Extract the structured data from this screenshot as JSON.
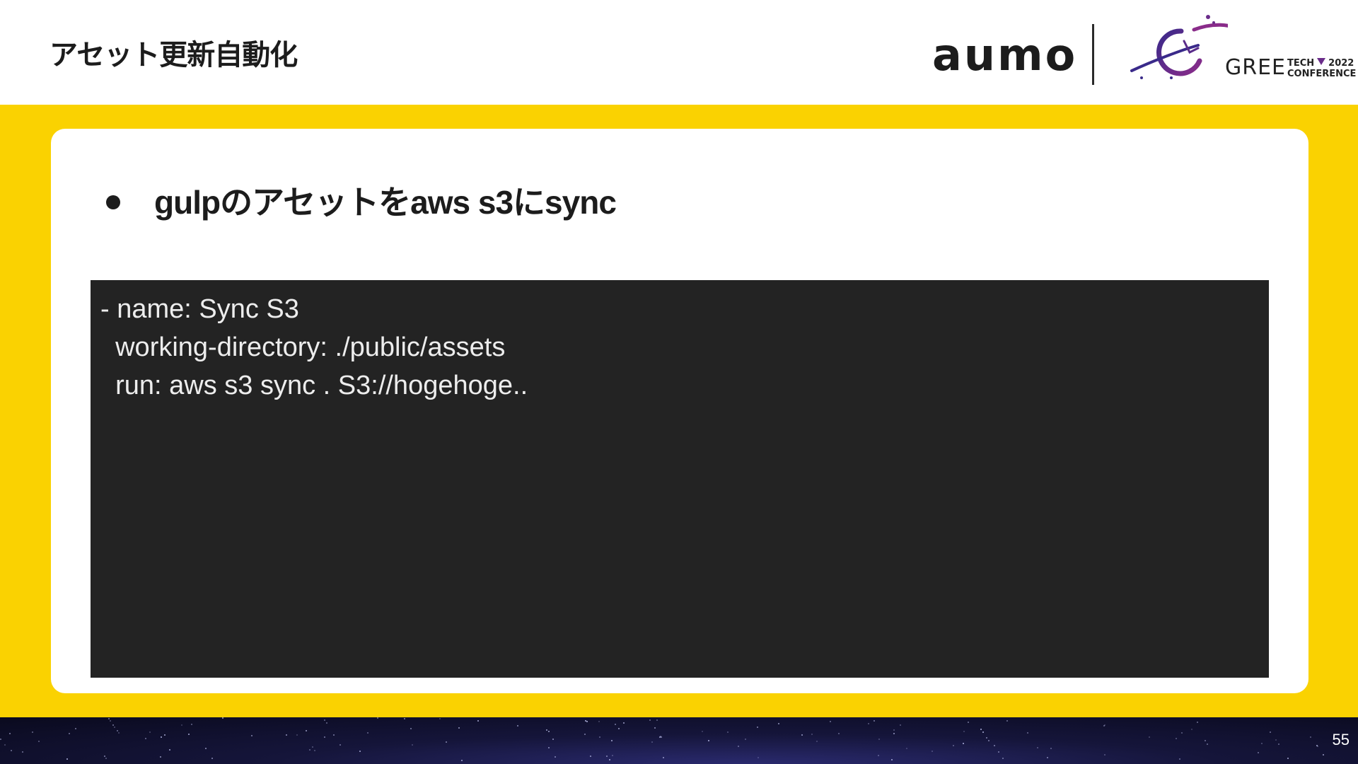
{
  "slide": {
    "title": "アセット更新自動化",
    "page_number": "55"
  },
  "logos": {
    "aumo": "aumo",
    "gree_word": "GREE",
    "gree_tech_line1": "TECH",
    "gree_year": "2022",
    "gree_tech_line2": "CONFERENCE"
  },
  "content": {
    "bullet": "gulpのアセットをaws s3にsync",
    "code_lines": [
      "- name: Sync S3",
      "  working-directory: ./public/assets",
      "  run: aws s3 sync . S3://hogehoge.."
    ]
  },
  "colors": {
    "accent_yellow": "#fad201",
    "code_background": "#232323",
    "gree_purple": "#6a2c8a",
    "footer_navy": "#15153a"
  }
}
